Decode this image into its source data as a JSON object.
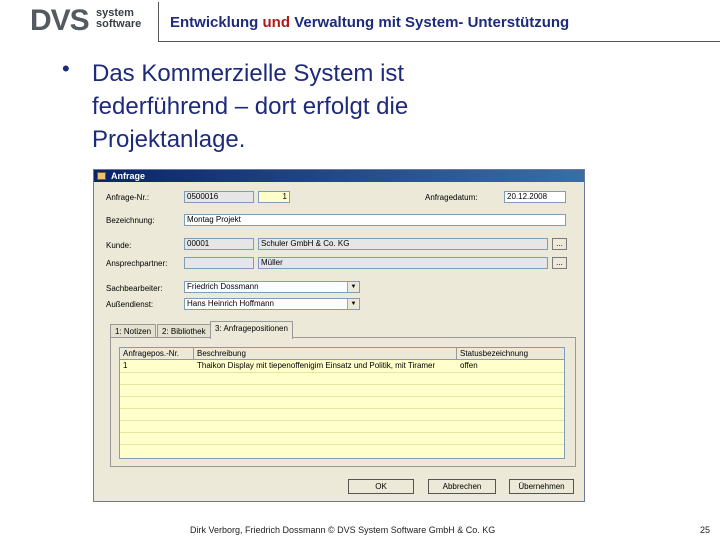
{
  "header": {
    "logo_main": "DVS",
    "logo_sub_line1": "system",
    "logo_sub_line2": "software",
    "title_part1": "Entwicklung",
    "title_part2": "und",
    "title_part3": "Verwaltung mit System- Unterstützung"
  },
  "slide": {
    "bullet_symbol": "•",
    "bullet_text": "Das  Kommerzielle System ist federführend – dort erfolgt die Projektanlage."
  },
  "window": {
    "title": "Anfrage",
    "fields": {
      "anfrage_nr_label": "Anfrage-Nr.:",
      "anfrage_nr_value": "0500016",
      "anfrage_nr_suffix": "1",
      "anfragedatum_label": "Anfragedatum:",
      "anfragedatum_value": "20.12.2008",
      "bezeichnung_label": "Bezeichnung:",
      "bezeichnung_value": "Montag Projekt",
      "kunde_label": "Kunde:",
      "kunde_nr": "00001",
      "kunde_name": "Schuler GmbH & Co. KG",
      "ansprechpartner_label": "Ansprechpartner:",
      "ansprechpartner_value": "Müller",
      "sachbearbeiter_label": "Sachbearbeiter:",
      "sachbearbeiter_value": "Friedrich Dossmann",
      "aussendienst_label": "Außendienst:",
      "aussendienst_value": "Hans Heinrich Hoffmann",
      "dots": "..."
    },
    "tabs": [
      {
        "label": "1: Notizen"
      },
      {
        "label": "2: Bibliothek"
      },
      {
        "label": "3: Anfragepositionen"
      }
    ],
    "grid": {
      "columns": [
        "Anfragepos.-Nr.",
        "Beschreibung",
        "Statusbezeichnung"
      ],
      "rows": [
        [
          "1",
          "Thaikon Display mit tiepenoffenigim Einsatz und Politik, mit Tiramer",
          "offen"
        ]
      ]
    },
    "buttons": {
      "ok": "OK",
      "abbrechen": "Abbrechen",
      "uebernehmen": "Übernehmen"
    }
  },
  "footer": {
    "text": "Dirk Verborg, Friedrich Dossmann © DVS System Software GmbH & Co. KG",
    "page_number": "25"
  },
  "colors": {
    "title_blue": "#1e2a7a",
    "title_red": "#b11a1a",
    "window_bg": "#ece9d8",
    "grid_yellow": "#ffffcc"
  }
}
